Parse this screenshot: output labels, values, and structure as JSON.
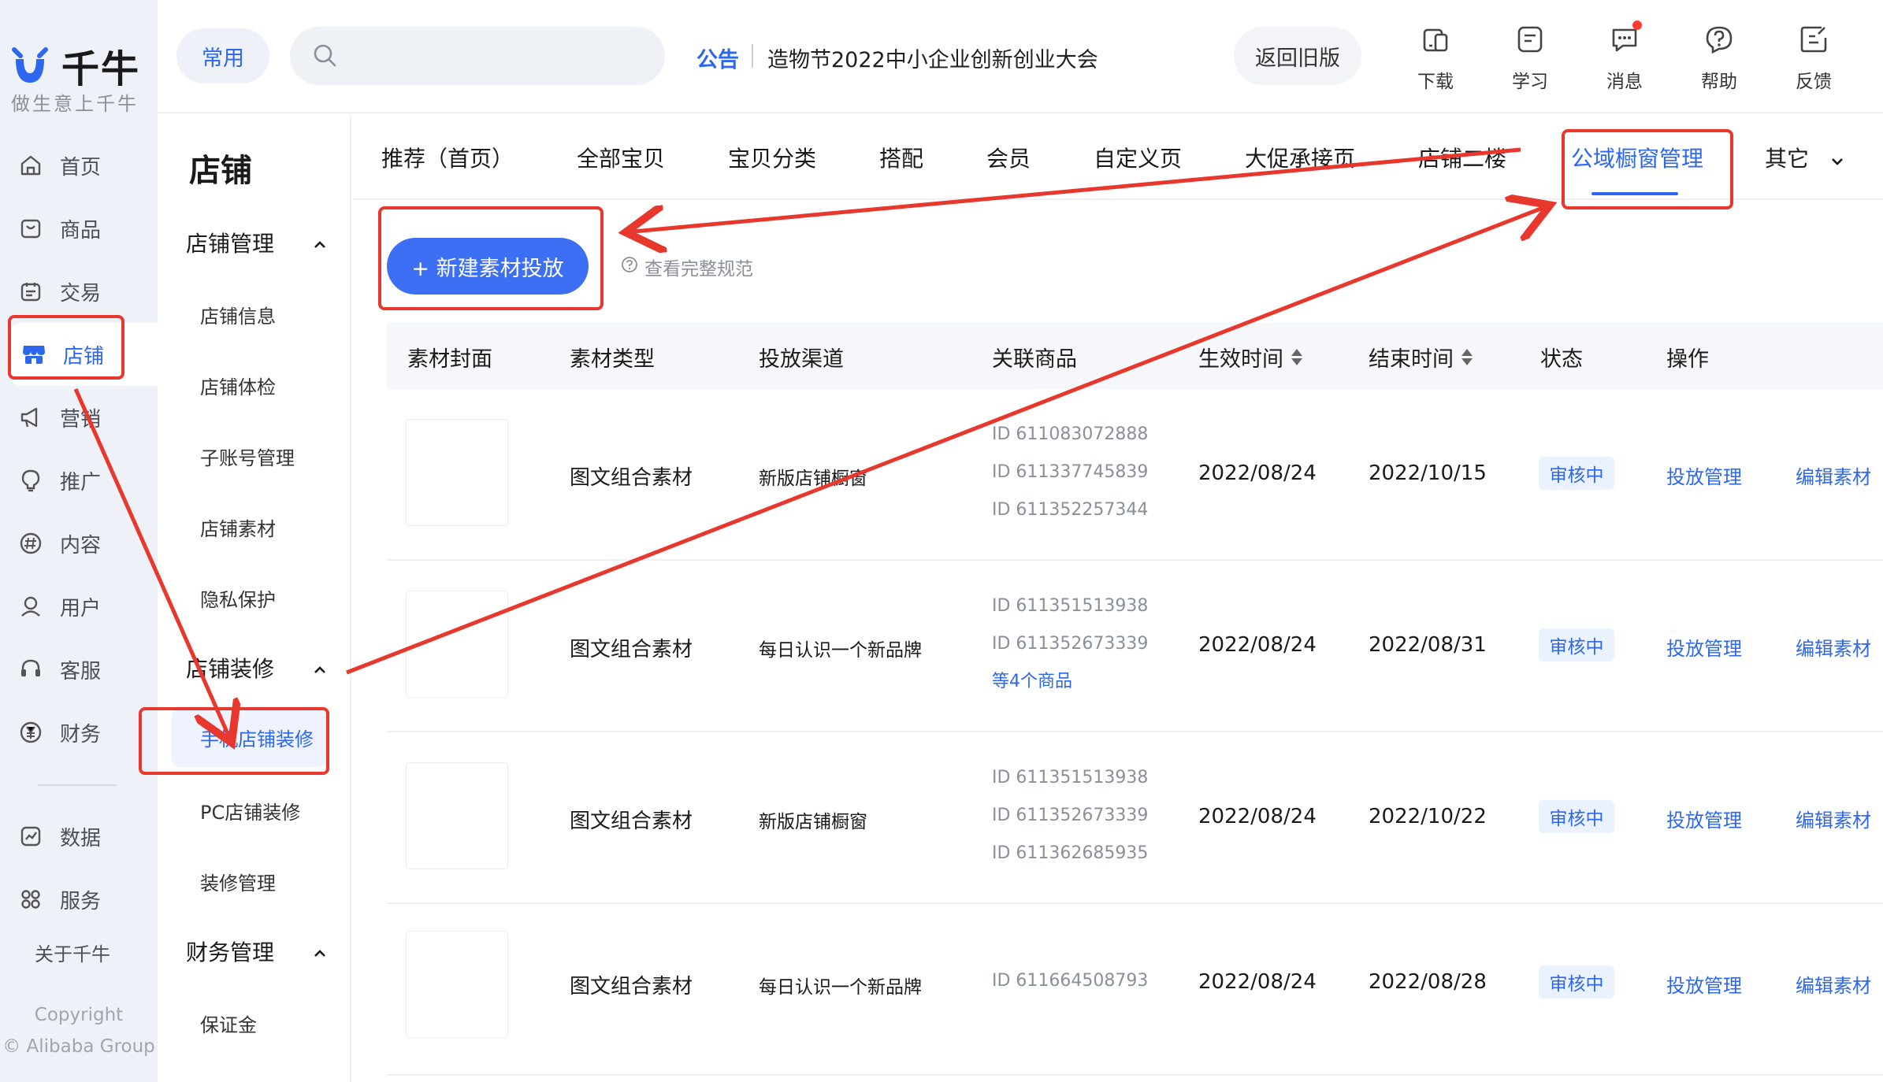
{
  "app": {
    "logo_text": "千牛",
    "slogan": "做生意上千牛",
    "accent": "#2d67f0",
    "annotation_color": "#e8372c"
  },
  "leftnav": {
    "items": [
      {
        "label": "首页",
        "icon": "home-icon"
      },
      {
        "label": "商品",
        "icon": "product-icon"
      },
      {
        "label": "交易",
        "icon": "trade-icon"
      },
      {
        "label": "店铺",
        "icon": "store-icon"
      },
      {
        "label": "营销",
        "icon": "megaphone-icon"
      },
      {
        "label": "推广",
        "icon": "bulb-icon"
      },
      {
        "label": "内容",
        "icon": "hashtag-icon"
      },
      {
        "label": "用户",
        "icon": "user-icon"
      },
      {
        "label": "客服",
        "icon": "headset-icon"
      },
      {
        "label": "财务",
        "icon": "yuan-icon"
      },
      {
        "label": "数据",
        "icon": "chart-icon"
      },
      {
        "label": "服务",
        "icon": "grid-icon"
      }
    ],
    "about": "关于千牛",
    "copyright_1": "Copyright",
    "copyright_2": "© Alibaba Group"
  },
  "topbar": {
    "common": "常用",
    "notice_tag": "公告",
    "notice_text": "造物节2022中小企业创新创业大会",
    "back_old": "返回旧版",
    "tools": [
      {
        "label": "下载",
        "icon": "download-icon"
      },
      {
        "label": "学习",
        "icon": "study-icon"
      },
      {
        "label": "消息",
        "icon": "message-icon"
      },
      {
        "label": "帮助",
        "icon": "help-icon"
      },
      {
        "label": "反馈",
        "icon": "feedback-icon"
      }
    ]
  },
  "subnav": {
    "title": "店铺",
    "group1": "店铺管理",
    "group1_items": [
      "店铺信息",
      "店铺体检",
      "子账号管理",
      "店铺素材",
      "隐私保护"
    ],
    "group2": "店铺装修",
    "group2_items": [
      "手机店铺装修",
      "PC店铺装修",
      "装修管理"
    ],
    "group3": "财务管理",
    "group3_items": [
      "保证金"
    ]
  },
  "tabs": [
    "推荐（首页）",
    "全部宝贝",
    "宝贝分类",
    "搭配",
    "会员",
    "自定义页",
    "大促承接页",
    "店铺二楼",
    "公域橱窗管理",
    "其它"
  ],
  "actions": {
    "new_button": "+ 新建素材投放",
    "spec_link": "查看完整规范"
  },
  "table": {
    "headers": [
      "素材封面",
      "素材类型",
      "投放渠道",
      "关联商品",
      "生效时间",
      "结束时间",
      "状态",
      "操作"
    ],
    "rows": [
      {
        "type": "图文组合素材",
        "channel": "新版店铺橱窗",
        "ids": [
          "ID 611083072888",
          "ID 611337745839",
          "ID 611352257344"
        ],
        "more": "",
        "start": "2022/08/24",
        "end": "2022/10/15",
        "status": "审核中",
        "op1": "投放管理",
        "op2": "编辑素材"
      },
      {
        "type": "图文组合素材",
        "channel": "每日认识一个新品牌",
        "ids": [
          "ID 611351513938",
          "ID 611352673339"
        ],
        "more": "等4个商品",
        "start": "2022/08/24",
        "end": "2022/08/31",
        "status": "审核中",
        "op1": "投放管理",
        "op2": "编辑素材"
      },
      {
        "type": "图文组合素材",
        "channel": "新版店铺橱窗",
        "ids": [
          "ID 611351513938",
          "ID 611352673339",
          "ID 611362685935"
        ],
        "more": "",
        "start": "2022/08/24",
        "end": "2022/10/22",
        "status": "审核中",
        "op1": "投放管理",
        "op2": "编辑素材"
      },
      {
        "type": "图文组合素材",
        "channel": "每日认识一个新品牌",
        "ids": [
          "ID 611664508793"
        ],
        "more": "",
        "start": "2022/08/24",
        "end": "2022/08/28",
        "status": "审核中",
        "op1": "投放管理",
        "op2": "编辑素材"
      }
    ]
  }
}
